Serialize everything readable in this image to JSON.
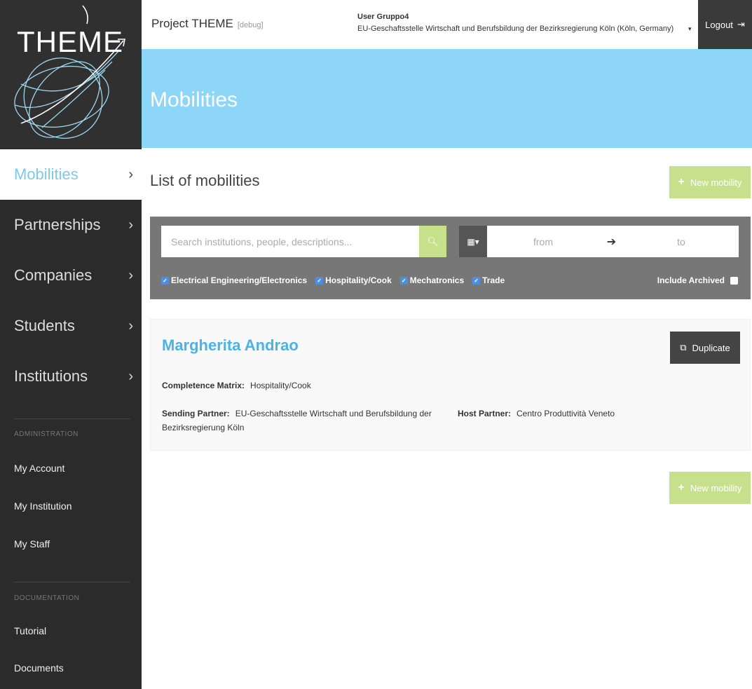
{
  "brand": {
    "logo_text": "THEME"
  },
  "header": {
    "project": "Project THEME",
    "debug": "[debug]",
    "user_name": "User Gruppo4",
    "user_institution": "EU-Geschaftsstelle Wirtschaft und Berufsbildung der Bezirksregierung Köln (Köln, Germany)",
    "caret_icon": "▾",
    "logout_label": "Logout",
    "logout_icon": "⇥"
  },
  "banner": {
    "title": "Mobilities"
  },
  "sidebar": {
    "items": [
      {
        "label": "Mobilities",
        "chevron": "›"
      },
      {
        "label": "Partnerships",
        "chevron": "›"
      },
      {
        "label": "Companies",
        "chevron": "›"
      },
      {
        "label": "Students",
        "chevron": "›"
      },
      {
        "label": "Institutions",
        "chevron": "›"
      }
    ],
    "admin_title": "ADMINISTRATION",
    "admin_items": [
      "My Account",
      "My Institution",
      "My Staff"
    ],
    "doc_title": "DOCUMENTATION",
    "doc_items": [
      "Tutorial",
      "Documents"
    ]
  },
  "main": {
    "list_title": "List of mobilities",
    "new_mobility_label": "New mobility",
    "plus_icon": "+",
    "search": {
      "placeholder": "Search institutions, people, descriptions...",
      "search_icon": "🔍︎",
      "calendar_icon": "▦▾",
      "from_placeholder": "from",
      "arrow_icon": "➔",
      "to_placeholder": "to"
    },
    "filters": [
      "Electrical Engineering/Electronics",
      "Hospitality/Cook",
      "Mechatronics",
      "Trade"
    ],
    "check_icon": "✓",
    "include_archived": "Include Archived",
    "card": {
      "name": "Margherita Andrao",
      "duplicate_label": "Duplicate",
      "duplicate_icon": "⧉",
      "matrix_label": "Completence Matrix:",
      "matrix_value": "Hospitality/Cook",
      "sending_label": "Sending Partner:",
      "sending_value": "EU-Geschaftsstelle Wirtschaft und Berufsbildung der",
      "sending_value_2": "Bezirksregierung Köln",
      "host_label": "Host Partner:",
      "host_value": "Centro Produttività Veneto"
    }
  },
  "colors": {
    "accent_blue": "#8ed6f8",
    "link_blue": "#4ab3e6",
    "button_green": "#c7e08c",
    "sidebar_dark": "#2b2b2b"
  }
}
